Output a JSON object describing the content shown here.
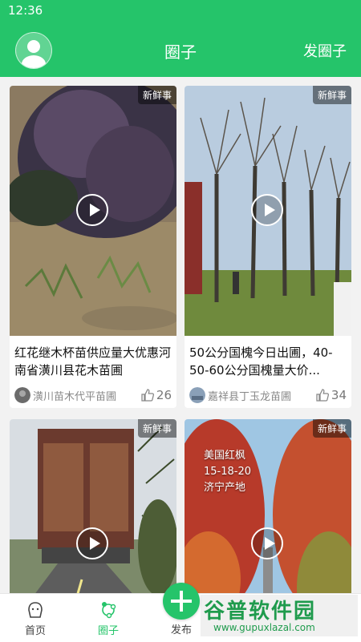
{
  "status_bar": {
    "time": "12:36"
  },
  "header": {
    "title": "圈子",
    "action": "发圈子"
  },
  "cards": [
    {
      "tag": "新鲜事",
      "title": "红花继木杯苗供应量大优惠河南省潢川县花木苗圃",
      "author": "潢川苗木代平苗圃",
      "likes": "26",
      "overlay": ""
    },
    {
      "tag": "新鲜事",
      "title": "50公分国槐今日出圃，40-50-60公分国槐量大价...",
      "author": "嘉祥县丁玉龙苗圃",
      "likes": "34",
      "overlay": ""
    },
    {
      "tag": "新鲜事",
      "title": "",
      "author": "",
      "likes": "",
      "overlay": ""
    },
    {
      "tag": "新鲜事",
      "title": "",
      "author": "",
      "likes": "",
      "overlay": "美国红枫\n15-18-20\n济宁产地"
    }
  ],
  "tabbar": {
    "home": "首页",
    "circle": "圈子",
    "publish": "发布"
  },
  "watermark": {
    "logo": "谷普软件园",
    "url": "www.gupuxlazal.com"
  },
  "colors": {
    "brand": "#25c46a"
  }
}
